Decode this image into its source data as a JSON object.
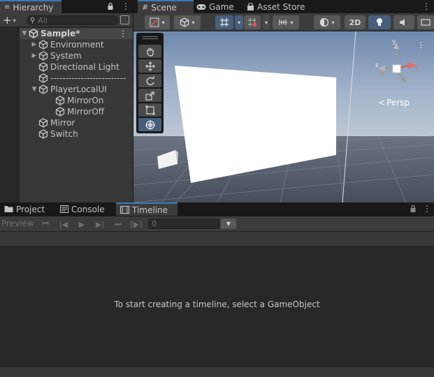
{
  "hierarchy": {
    "tab_label": "Hierarchy",
    "add_label": "+",
    "search_placeholder": "All",
    "scene_name": "Sample*",
    "items": [
      {
        "label": "Environment",
        "has_children": true,
        "expanded": false
      },
      {
        "label": "System",
        "has_children": true,
        "expanded": false
      },
      {
        "label": "Directional Light",
        "has_children": false
      },
      {
        "label": "-------------------------",
        "has_children": false
      },
      {
        "label": "PlayerLocalUI",
        "has_children": true,
        "expanded": true
      },
      {
        "label": "MirrorOn",
        "has_children": false,
        "child": true
      },
      {
        "label": "MirrorOff",
        "has_children": false,
        "child": true
      },
      {
        "label": "Mirror",
        "has_children": false
      },
      {
        "label": "Switch",
        "has_children": false
      }
    ]
  },
  "scene": {
    "tabs": [
      {
        "label": "Scene",
        "icon": "grid-icon",
        "active": true
      },
      {
        "label": "Game",
        "icon": "gamepad-icon",
        "active": false
      },
      {
        "label": "Asset Store",
        "icon": "store-icon",
        "active": false
      }
    ],
    "toggle_2d": "2D",
    "persp_label": "Persp",
    "gizmo_axes": {
      "y": "y",
      "z": "z",
      "x": "x"
    },
    "tools": [
      "view-tool",
      "move-tool",
      "rotate-tool",
      "scale-tool",
      "rect-tool",
      "transform-tool"
    ],
    "active_tool": "transform-tool"
  },
  "bottom": {
    "tabs": [
      {
        "label": "Project",
        "icon": "folder-icon",
        "active": false
      },
      {
        "label": "Console",
        "icon": "console-icon",
        "active": false
      },
      {
        "label": "Timeline",
        "icon": "timeline-icon",
        "active": true
      }
    ],
    "preview_label": "Preview",
    "frame_value": "0",
    "empty_message": "To start creating a timeline, select a GameObject"
  },
  "colors": {
    "accent": "#3a79bb",
    "panel": "#282828",
    "toolbar": "#3c3c3c",
    "active_button": "#46607c",
    "sky_top": "#6f88ad",
    "ground": "#4a5262"
  }
}
